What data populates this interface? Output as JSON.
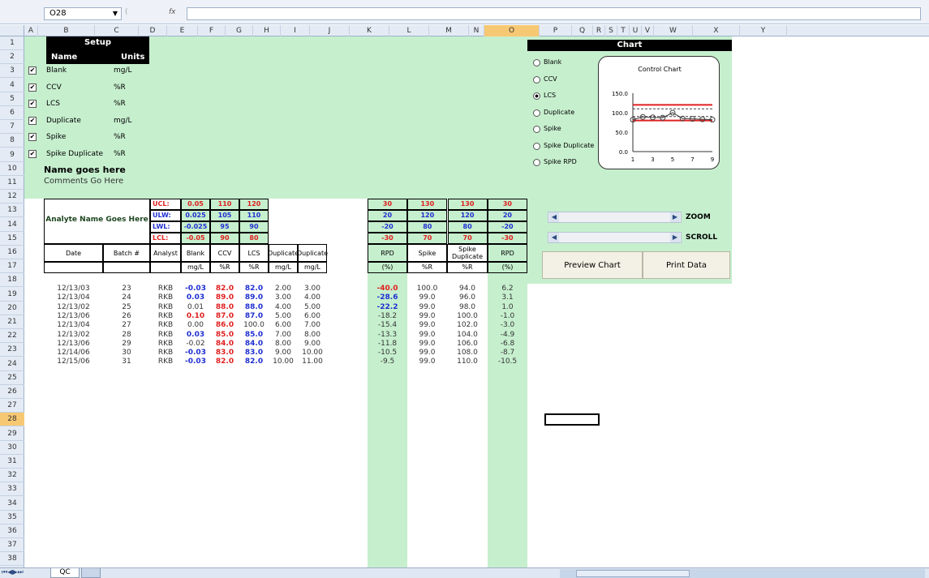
{
  "formula_bar": {
    "cell_ref": "O28",
    "fx": "fx"
  },
  "columns": [
    "A",
    "B",
    "C",
    "D",
    "E",
    "F",
    "G",
    "H",
    "I",
    "J",
    "K",
    "L",
    "M",
    "N",
    "O",
    "P",
    "Q",
    "R",
    "S",
    "T",
    "U",
    "V",
    "W",
    "X",
    "Y"
  ],
  "rows": [
    "1",
    "2",
    "3",
    "4",
    "5",
    "6",
    "7",
    "8",
    "9",
    "10",
    "11",
    "12",
    "13",
    "14",
    "15",
    "16",
    "17",
    "18",
    "19",
    "20",
    "21",
    "22",
    "23",
    "24",
    "25",
    "26",
    "27",
    "28",
    "29",
    "30",
    "31",
    "32",
    "33",
    "34",
    "35",
    "36",
    "37",
    "38"
  ],
  "setup": {
    "title": "Setup",
    "name_header": "Name",
    "units_header": "Units",
    "items": [
      {
        "name": "Blank",
        "unit": "mg/L"
      },
      {
        "name": "CCV",
        "unit": "%R"
      },
      {
        "name": "LCS",
        "unit": "%R"
      },
      {
        "name": "Duplicate",
        "unit": "mg/L"
      },
      {
        "name": "Spike",
        "unit": "%R"
      },
      {
        "name": "Spike Duplicate",
        "unit": "%R"
      }
    ]
  },
  "name_text": "Name goes here",
  "comments_text": "Comments Go Here",
  "analyte": "Analyte Name Goes Here",
  "limit_labels": [
    "UCL:",
    "ULW:",
    "LWL:",
    "LCL:"
  ],
  "limits_left": [
    [
      "0.05",
      "110",
      "120"
    ],
    [
      "0.025",
      "105",
      "110"
    ],
    [
      "-0.025",
      "95",
      "90"
    ],
    [
      "-0.05",
      "90",
      "80"
    ]
  ],
  "limits_right": [
    [
      "30",
      "130",
      "130",
      "30"
    ],
    [
      "20",
      "120",
      "120",
      "20"
    ],
    [
      "-20",
      "80",
      "80",
      "-20"
    ],
    [
      "-30",
      "70",
      "70",
      "-30"
    ]
  ],
  "headers": [
    "Date",
    "Batch #",
    "Analyst",
    "Blank",
    "CCV",
    "LCS",
    "Duplicate",
    "Duplicate",
    "RPD",
    "Spike",
    "Spike Duplicate",
    "RPD"
  ],
  "units": [
    "",
    "",
    "",
    "mg/L",
    "%R",
    "%R",
    "mg/L",
    "mg/L",
    "(%)",
    "%R",
    "%R",
    "(%)"
  ],
  "data_rows": [
    [
      "12/13/03",
      "23",
      "RKB",
      "-0.03",
      "82.0",
      "82.0",
      "2.00",
      "3.00",
      "-40.0",
      "100.0",
      "94.0",
      "6.2"
    ],
    [
      "12/13/04",
      "24",
      "RKB",
      "0.03",
      "89.0",
      "89.0",
      "3.00",
      "4.00",
      "-28.6",
      "99.0",
      "96.0",
      "3.1"
    ],
    [
      "12/13/02",
      "25",
      "RKB",
      "0.01",
      "88.0",
      "88.0",
      "4.00",
      "5.00",
      "-22.2",
      "99.0",
      "98.0",
      "1.0"
    ],
    [
      "12/13/06",
      "26",
      "RKB",
      "0.10",
      "87.0",
      "87.0",
      "5.00",
      "6.00",
      "-18.2",
      "99.0",
      "100.0",
      "-1.0"
    ],
    [
      "12/13/04",
      "27",
      "RKB",
      "0.00",
      "86.0",
      "100.0",
      "6.00",
      "7.00",
      "-15.4",
      "99.0",
      "102.0",
      "-3.0"
    ],
    [
      "12/13/02",
      "28",
      "RKB",
      "0.03",
      "85.0",
      "85.0",
      "7.00",
      "8.00",
      "-13.3",
      "99.0",
      "104.0",
      "-4.9"
    ],
    [
      "12/13/06",
      "29",
      "RKB",
      "-0.02",
      "84.0",
      "84.0",
      "8.00",
      "9.00",
      "-11.8",
      "99.0",
      "106.0",
      "-6.8"
    ],
    [
      "12/14/06",
      "30",
      "RKB",
      "-0.03",
      "83.0",
      "83.0",
      "9.00",
      "10.00",
      "-10.5",
      "99.0",
      "108.0",
      "-8.7"
    ],
    [
      "12/15/06",
      "31",
      "RKB",
      "-0.03",
      "82.0",
      "82.0",
      "10.00",
      "11.00",
      "-9.5",
      "99.0",
      "110.0",
      "-10.5"
    ]
  ],
  "chart_panel": {
    "title": "Chart",
    "options": [
      "Blank",
      "CCV",
      "LCS",
      "Duplicate",
      "Spike",
      "Spike Duplicate",
      "Spike RPD"
    ],
    "selected": "LCS",
    "zoom_label": "ZOOM",
    "scroll_label": "SCROLL",
    "preview_button": "Preview Chart",
    "print_button": "Print Data"
  },
  "chart_data": {
    "type": "line",
    "title": "Control Chart",
    "x": [
      1,
      2,
      3,
      4,
      5,
      6,
      7,
      8,
      9
    ],
    "x_ticks": [
      "1",
      "3",
      "5",
      "7",
      "9"
    ],
    "y_ticks": [
      "150.0",
      "100.0",
      "50.0",
      "0.0"
    ],
    "ylim": [
      0,
      150
    ],
    "series": [
      {
        "values": [
          82,
          89,
          88,
          87,
          100,
          85,
          84,
          83,
          82
        ],
        "color": "#404040"
      }
    ],
    "limit_lines": [
      {
        "value": 120,
        "color": "#e02020"
      },
      {
        "value": 110,
        "color": "#404040"
      },
      {
        "value": 90,
        "color": "#404040"
      },
      {
        "value": 80,
        "color": "#e02020"
      }
    ]
  },
  "sheet_tab": "QC",
  "colors": {
    "green": "#c6efce",
    "blue": "#1f2fd0",
    "red": "#e02020"
  }
}
